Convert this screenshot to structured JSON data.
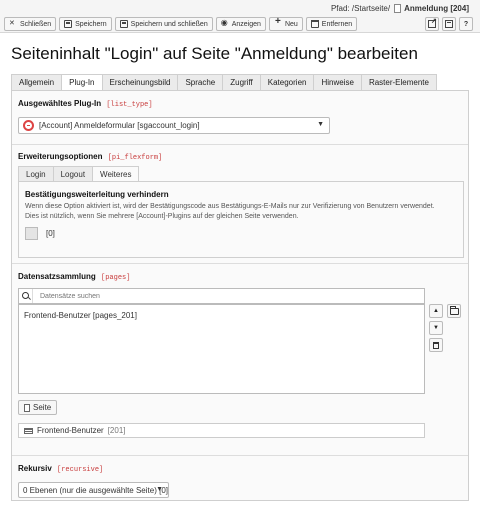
{
  "path": {
    "prefix": "Pfad: /Startseite/",
    "current": "Anmeldung [204]"
  },
  "toolbar": {
    "close_label": "Schließen",
    "save_label": "Speichern",
    "save_close_label": "Speichern und schließen",
    "view_label": "Anzeigen",
    "new_label": "Neu",
    "delete_label": "Entfernen",
    "help_label": "?"
  },
  "page_title": "Seiteninhalt \"Login\" auf Seite \"Anmeldung\" bearbeiten",
  "tabs": [
    {
      "label": "Allgemein",
      "active": false
    },
    {
      "label": "Plug-In",
      "active": true
    },
    {
      "label": "Erscheinungsbild",
      "active": false
    },
    {
      "label": "Sprache",
      "active": false
    },
    {
      "label": "Zugriff",
      "active": false
    },
    {
      "label": "Kategorien",
      "active": false
    },
    {
      "label": "Hinweise",
      "active": false
    },
    {
      "label": "Raster-Elemente",
      "active": false
    }
  ],
  "plugin": {
    "label": "Ausgewähltes Plug-In",
    "code": "[list_type]",
    "selected": "[Account] Anmeldeformular [sgaccount_login]"
  },
  "flexform": {
    "label": "Erweiterungsoptionen",
    "code": "[pi_flexform]",
    "subtabs": [
      "Login",
      "Logout",
      "Weiteres"
    ],
    "active_subtab": "Weiteres",
    "option_title": "Bestätigungsweiterleitung verhindern",
    "option_desc_1": "Wenn diese Option aktiviert ist, wird der Bestätigungscode aus Bestätigungs-E-Mails nur zur Verifizierung von Benutzern verwendet.",
    "option_desc_2": "Dies ist nützlich, wenn Sie mehrere [Account]-Plugins auf der gleichen Seite verwenden.",
    "checkbox_value": "[0]"
  },
  "pages": {
    "label": "Datensatzsammlung",
    "code": "[pages]",
    "search_placeholder": "Datensätze suchen",
    "list_items": [
      "Frontend-Benutzer [pages_201]"
    ],
    "page_button_label": "Seite",
    "selected_title": "Frontend-Benutzer",
    "selected_uid": "[201]"
  },
  "recursive": {
    "label": "Rekursiv",
    "code": "[recursive]",
    "selected": "0 Ebenen (nur die ausgewählte Seite) [0]"
  },
  "colors": {
    "code_red": "#c83c3c",
    "panel_bg": "#fafafa",
    "border": "#cfcfcf"
  }
}
